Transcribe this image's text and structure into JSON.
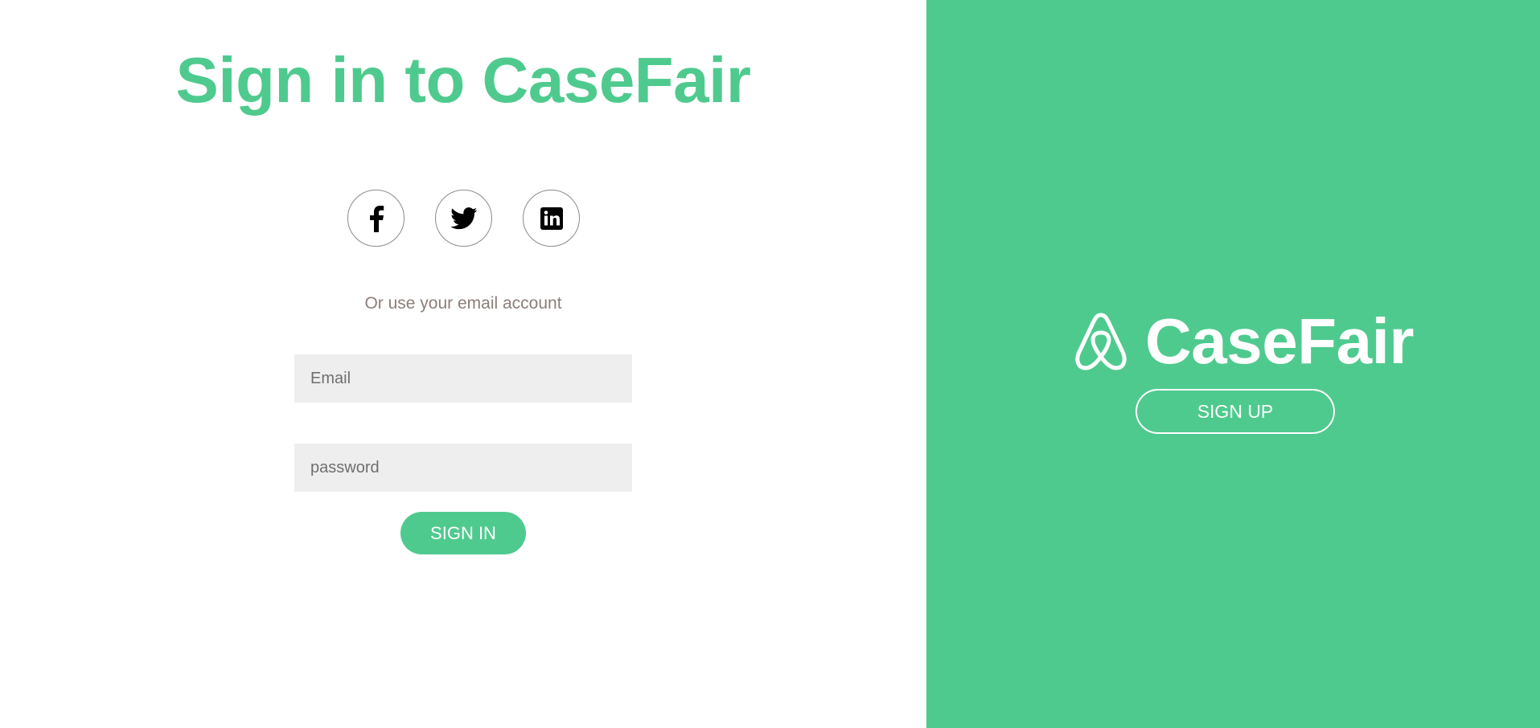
{
  "sign_in": {
    "title": "Sign in to CaseFair",
    "social": [
      {
        "icon": "facebook-icon",
        "name": "Facebook"
      },
      {
        "icon": "twitter-icon",
        "name": "Twitter"
      },
      {
        "icon": "linkedin-icon",
        "name": "LinkedIn"
      }
    ],
    "or_text": "Or use your email account",
    "email_placeholder": "Email",
    "email_value": "",
    "password_placeholder": "password",
    "password_value": "",
    "signin_label": "SIGN IN"
  },
  "side_panel": {
    "brand_icon": "airbnb-logo-icon",
    "brand_name": "CaseFair",
    "signup_label": "SIGN UP"
  },
  "colors": {
    "accent": "#4fca8e",
    "muted_text": "#8c7e78",
    "field_bg": "#eeeeee"
  }
}
